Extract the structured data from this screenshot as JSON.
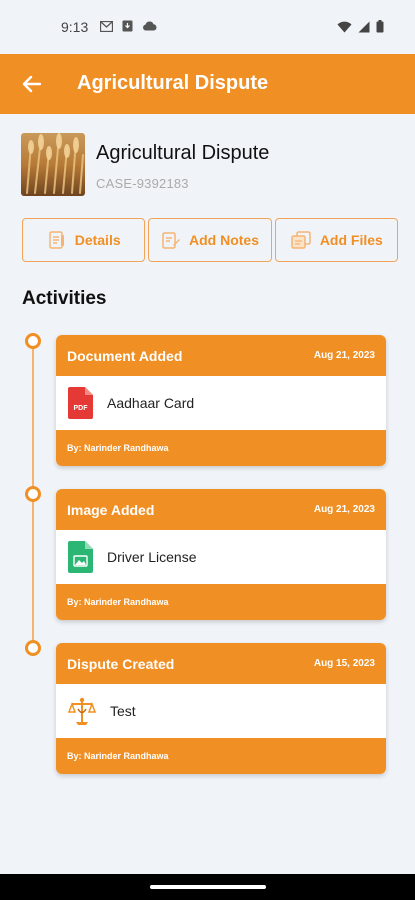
{
  "status_bar": {
    "time": "9:13",
    "left_icons": [
      "gmail-icon",
      "download-notification-icon",
      "cloud-icon"
    ],
    "right_icons": [
      "wifi-icon",
      "signal-icon",
      "battery-icon"
    ]
  },
  "header": {
    "title": "Agricultural Dispute",
    "back_icon": "arrow-left-icon"
  },
  "case": {
    "title": "Agricultural Dispute",
    "id": "CASE-9392183",
    "thumbnail": "wheat-field-photo"
  },
  "actions": [
    {
      "label": "Details",
      "icon": "document-icon"
    },
    {
      "label": "Add Notes",
      "icon": "edit-note-icon"
    },
    {
      "label": "Add Files",
      "icon": "files-icon"
    }
  ],
  "activities_heading": "Activities",
  "activities": [
    {
      "type": "Document Added",
      "date": "Aug 21, 2023",
      "file": "Aadhaar Card",
      "icon": "pdf-file-icon",
      "by": "By: Narinder Randhawa"
    },
    {
      "type": "Image Added",
      "date": "Aug 21, 2023",
      "file": "Driver License",
      "icon": "image-file-icon",
      "by": "By: Narinder Randhawa"
    },
    {
      "type": "Dispute Created",
      "date": "Aug 15, 2023",
      "file": "Test",
      "icon": "justice-logo-icon",
      "by": "By: Narinder Randhawa"
    }
  ],
  "colors": {
    "accent": "#f08f24",
    "background": "#f0f4f8",
    "pdf": "#e53935",
    "image": "#2bb673"
  }
}
